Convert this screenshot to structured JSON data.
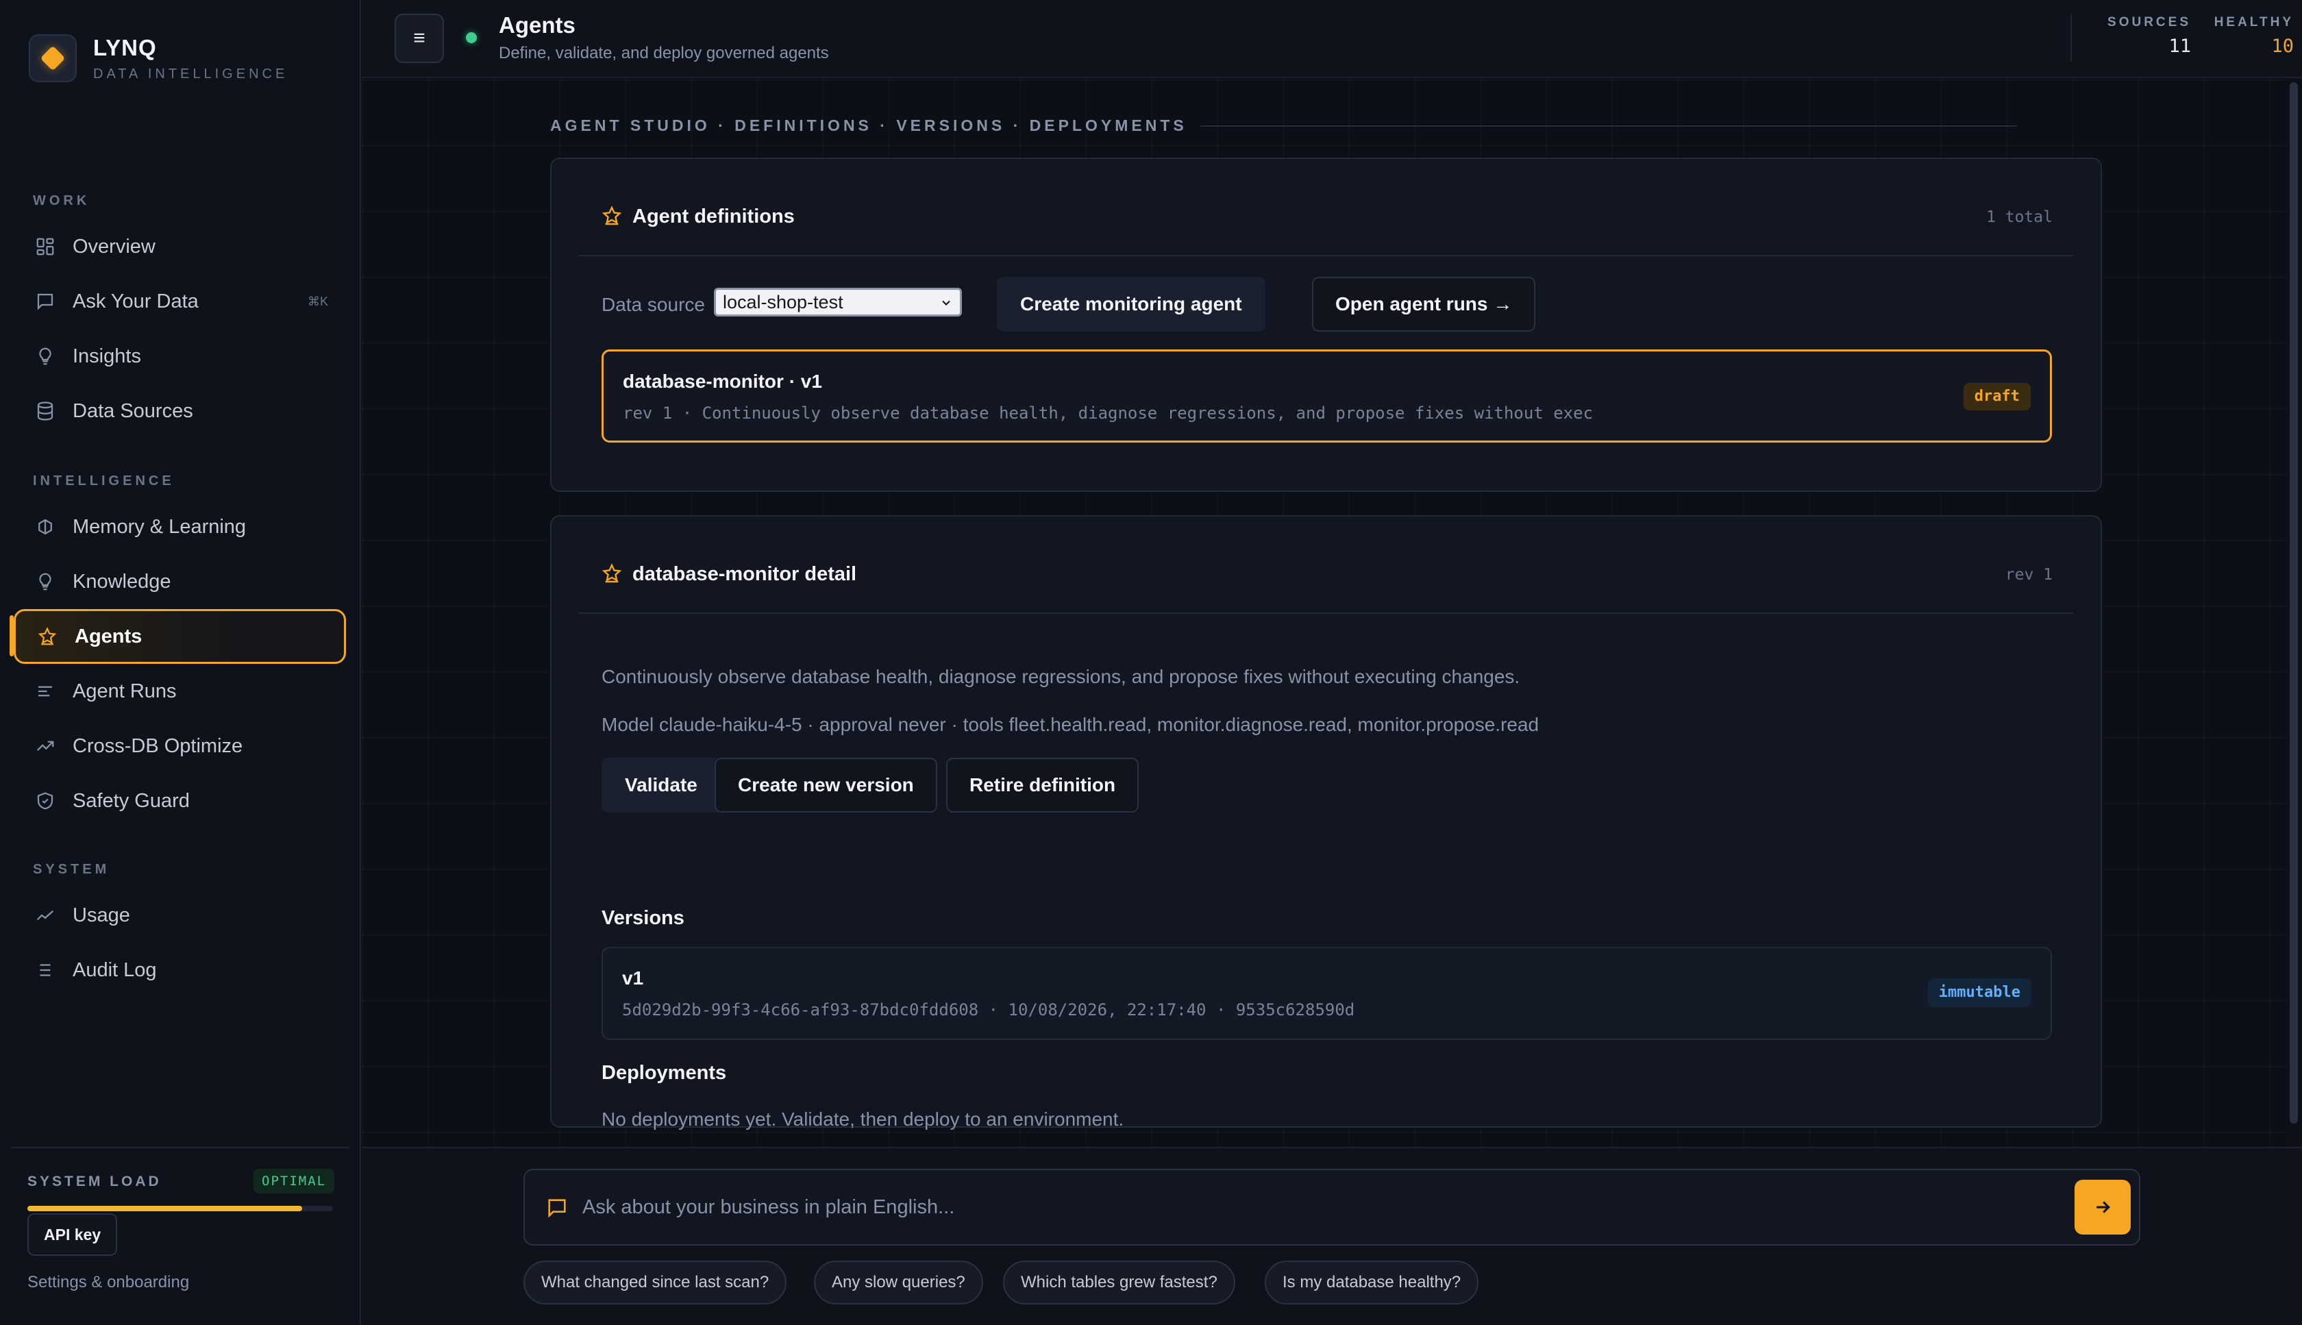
{
  "brand": {
    "name": "LYNQ",
    "subtitle": "DATA INTELLIGENCE"
  },
  "nav": {
    "work": {
      "heading": "WORK",
      "items": [
        {
          "label": "Overview",
          "icon": "grid-icon"
        },
        {
          "label": "Ask Your Data",
          "icon": "chat-icon",
          "shortcut": "⌘K"
        },
        {
          "label": "Insights",
          "icon": "lightbulb-icon"
        },
        {
          "label": "Data Sources",
          "icon": "database-icon"
        }
      ]
    },
    "intelligence": {
      "heading": "INTELLIGENCE",
      "items": [
        {
          "label": "Memory & Learning",
          "icon": "brain-icon"
        },
        {
          "label": "Knowledge",
          "icon": "lightbulb-icon"
        },
        {
          "label": "Agents",
          "icon": "star-icon",
          "active": true
        },
        {
          "label": "Agent Runs",
          "icon": "list-icon"
        },
        {
          "label": "Cross-DB Optimize",
          "icon": "trend-up-icon"
        },
        {
          "label": "Safety Guard",
          "icon": "shield-icon"
        }
      ]
    },
    "system": {
      "heading": "SYSTEM",
      "items": [
        {
          "label": "Usage",
          "icon": "chart-line-icon"
        },
        {
          "label": "Audit Log",
          "icon": "menu-list-icon"
        }
      ]
    }
  },
  "system_load": {
    "label": "SYSTEM LOAD",
    "status": "OPTIMAL",
    "level_percent": 90
  },
  "sidebar_footer": {
    "api_key_label": "API key",
    "settings_label": "Settings & onboarding"
  },
  "topbar": {
    "menu_glyph": "≡",
    "title": "Agents",
    "subtitle": "Define, validate, and deploy governed agents",
    "stats": [
      {
        "key": "SOURCES",
        "value": "11",
        "color": "#e6e8ee"
      },
      {
        "key": "HEALTHY",
        "value": "10",
        "color": "#f5a623"
      }
    ]
  },
  "breadcrumb": "AGENT STUDIO · DEFINITIONS · VERSIONS · DEPLOYMENTS",
  "definitions_card": {
    "title": "Agent definitions",
    "count": "1 total",
    "data_source_label": "Data source",
    "data_source_value": "local-shop-test",
    "create_button": "Create monitoring agent",
    "runs_button": "Open agent runs →",
    "definition": {
      "name": "database-monitor · v1",
      "description": "rev 1 · Continuously observe database health, diagnose regressions, and propose fixes without exec",
      "status": "draft"
    }
  },
  "detail_card": {
    "title": "database-monitor detail",
    "rev": "rev 1",
    "description": "Continuously observe database health, diagnose regressions, and propose fixes without executing changes.",
    "model_line": "Model claude-haiku-4-5 · approval never · tools fleet.health.read, monitor.diagnose.read, monitor.propose.read",
    "buttons": {
      "validate": "Validate",
      "new_version": "Create new version",
      "retire": "Retire definition"
    },
    "versions_heading": "Versions",
    "version": {
      "name": "v1",
      "meta": "5d029d2b-99f3-4c66-af93-87bdc0fdd608 · 10/08/2026, 22:17:40 · 9535c628590d",
      "badge": "immutable"
    },
    "deployments_heading": "Deployments",
    "deployments_empty": "No deployments yet. Validate, then deploy to an environment."
  },
  "prompt": {
    "placeholder": "Ask about your business in plain English...",
    "suggestions": [
      "What changed since last scan?",
      "Any slow queries?",
      "Which tables grew fastest?",
      "Is my database healthy?"
    ]
  },
  "colors": {
    "accent": "#f5a623",
    "success": "#3ecf8e",
    "info": "#5fb1ff",
    "background": "#0c1018"
  }
}
